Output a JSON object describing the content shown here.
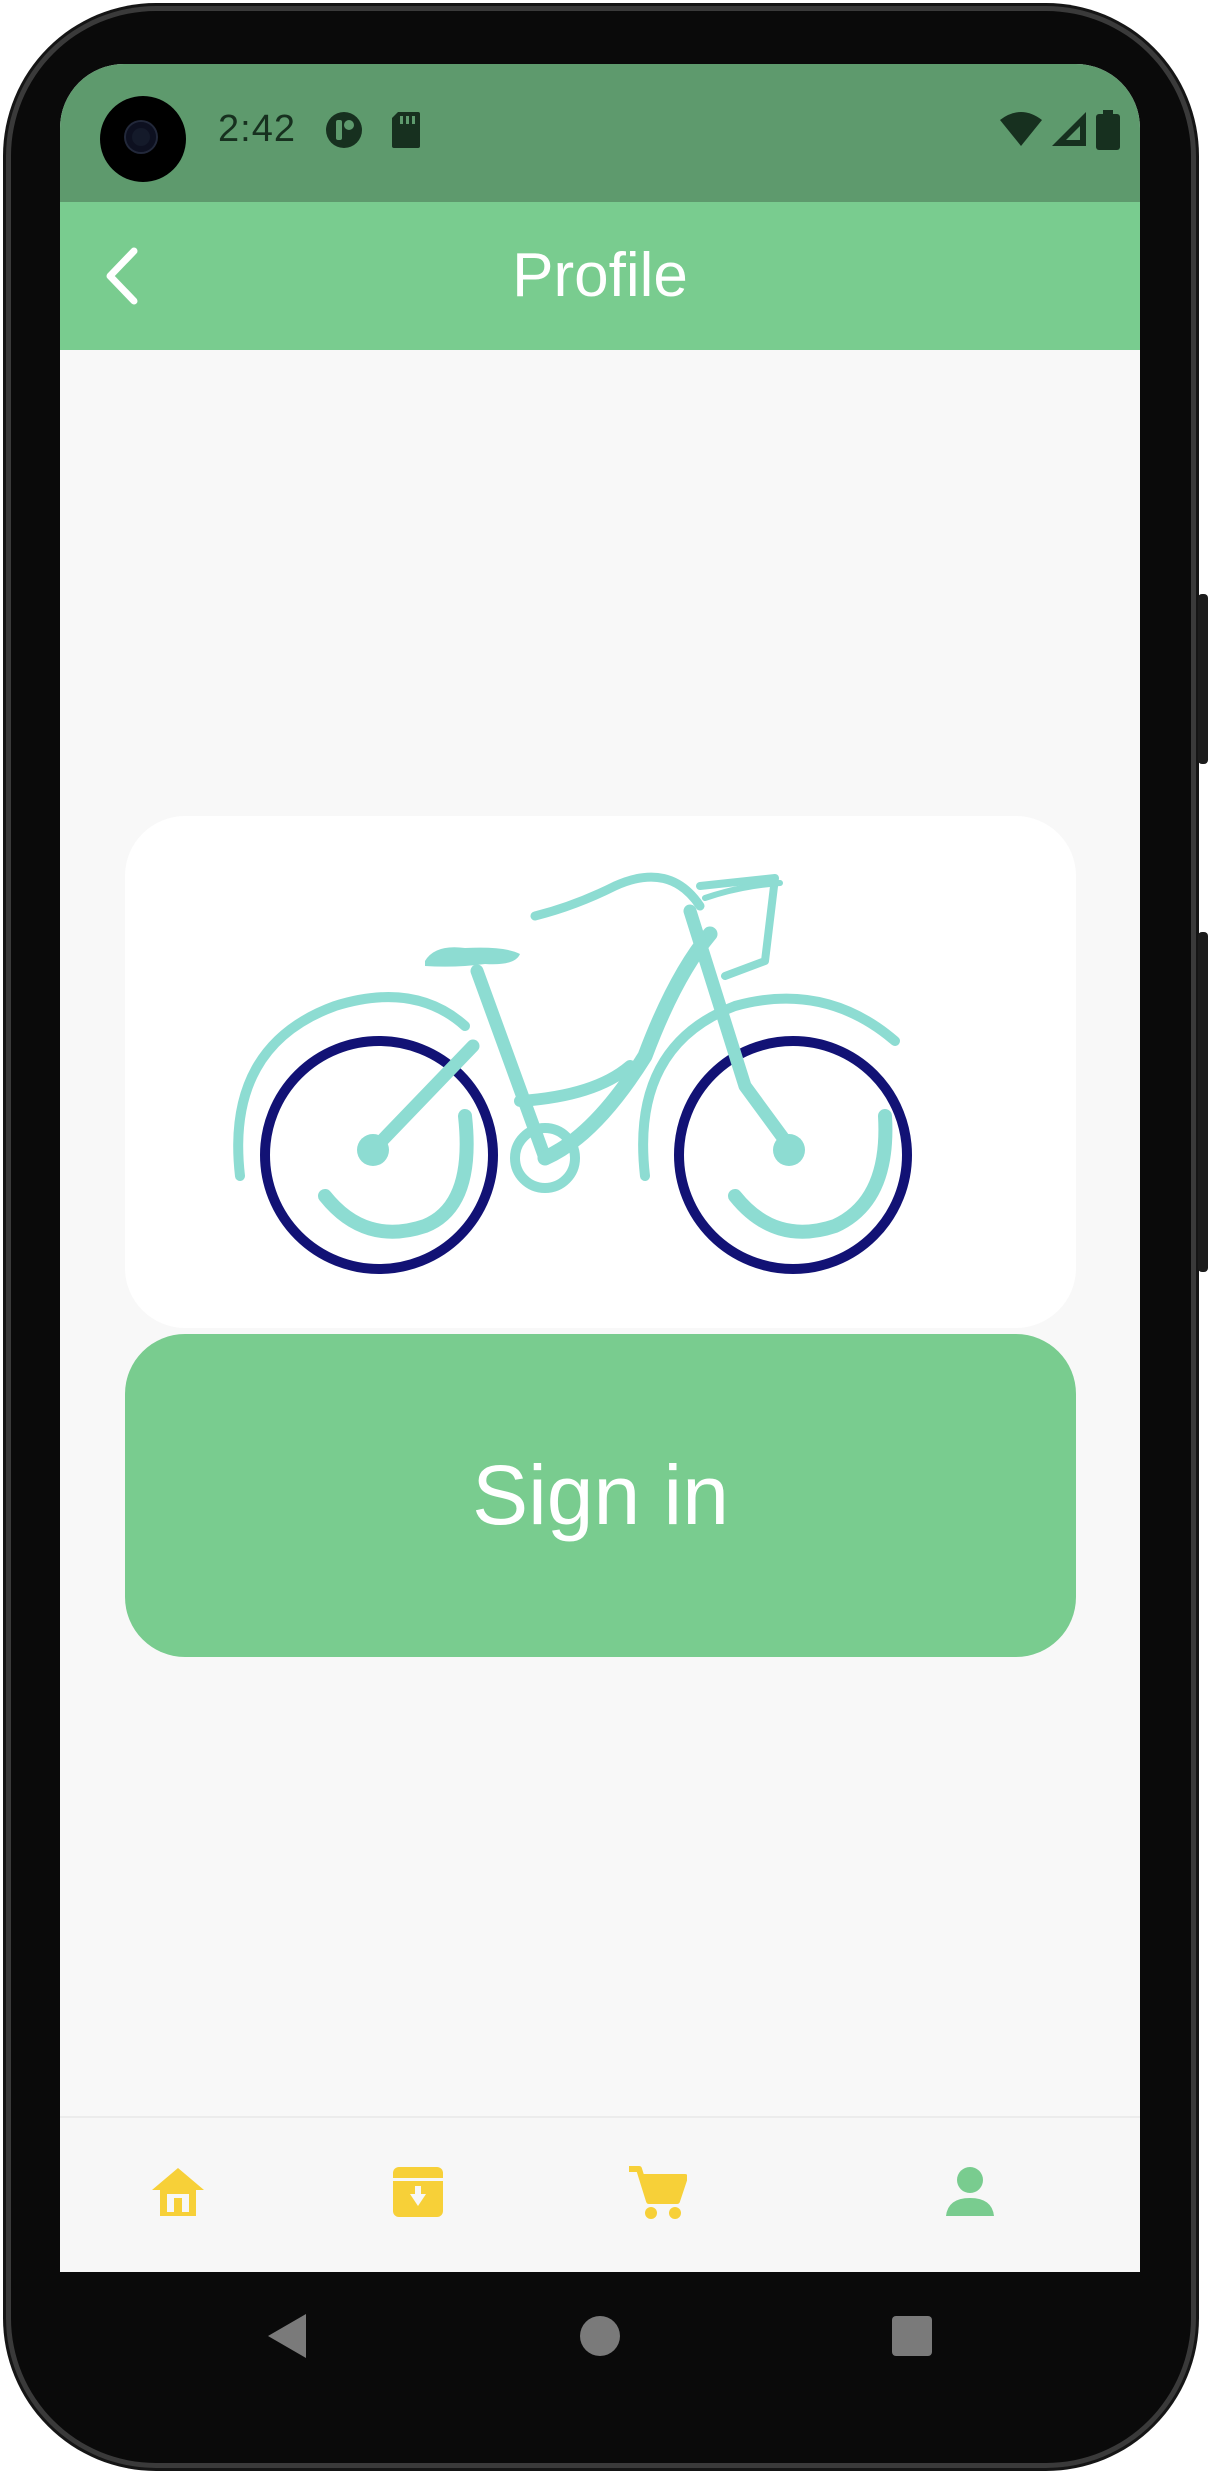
{
  "status_bar": {
    "time": "2:42",
    "left_icons": [
      "sync-app-icon",
      "sd-card-icon"
    ],
    "right_icons": [
      "wifi-icon",
      "signal-icon",
      "battery-icon"
    ]
  },
  "header": {
    "title": "Profile",
    "back_icon": "chevron-left-icon"
  },
  "main": {
    "logo": "bicycle-logo",
    "sign_in_label": "Sign in"
  },
  "bottom_nav": {
    "items": [
      {
        "icon": "home-icon",
        "active": false
      },
      {
        "icon": "archive-download-icon",
        "active": false
      },
      {
        "icon": "cart-icon",
        "active": false
      },
      {
        "icon": "person-icon",
        "active": true
      }
    ]
  },
  "system_nav": [
    "back-triangle-icon",
    "home-circle-icon",
    "recents-square-icon"
  ],
  "colors": {
    "status_bar": "#5e9a6d",
    "app_bar": "#79cc8f",
    "accent_green": "#79cc8f",
    "nav_inactive": "#f7d038",
    "bike_teal": "#8ddcd2",
    "bike_wheel": "#121275",
    "background": "#f8f8f8"
  }
}
